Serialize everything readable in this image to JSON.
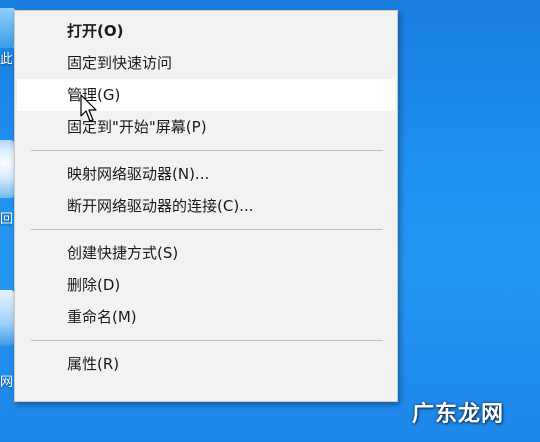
{
  "desktop": {
    "icons": [
      {
        "label": "此"
      },
      {
        "label": "回"
      },
      {
        "label": "网"
      }
    ]
  },
  "menu": {
    "groups": [
      [
        {
          "label": "打开(O)",
          "bold": true
        },
        {
          "label": "固定到快速访问"
        },
        {
          "label": "管理(G)",
          "hover": true
        },
        {
          "label": "固定到\"开始\"屏幕(P)"
        }
      ],
      [
        {
          "label": "映射网络驱动器(N)..."
        },
        {
          "label": "断开网络驱动器的连接(C)..."
        }
      ],
      [
        {
          "label": "创建快捷方式(S)"
        },
        {
          "label": "删除(D)"
        },
        {
          "label": "重命名(M)"
        }
      ],
      [
        {
          "label": "属性(R)"
        }
      ]
    ]
  },
  "watermark": "广东龙网"
}
